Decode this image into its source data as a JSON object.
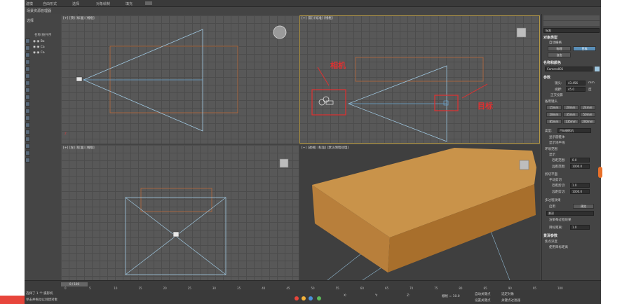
{
  "ribbon": {
    "items": [
      "建模",
      "自由形式",
      "选择",
      "对象绘制",
      "填充"
    ]
  },
  "left_panel": {
    "title": "场景资源管理器",
    "header": "选择",
    "sort_label": "名称(按升序",
    "objects": [
      "Bo",
      "Ca",
      "Ca"
    ]
  },
  "viewports": {
    "top_left": "[+] [顶] [标准] [线框]",
    "top_right": "[+] [前] [标准] [线框]",
    "bottom_left": "[+] [左] [标准] [线框]",
    "bottom_right": "[+] [透视] [标准] [默认明暗处理]"
  },
  "annotations": {
    "camera": "相机",
    "target": "目标"
  },
  "right_panel": {
    "top_select": "标准",
    "object_type_title": "对象类型",
    "auto_grid": "自动栅格",
    "btn_physical": "物理",
    "btn_target": "目标",
    "btn_free": "自由",
    "name_color_title": "名称和颜色",
    "camera_name": "Camera001",
    "params_title": "参数",
    "lens_label": "镜头:",
    "lens_value": "43.456",
    "lens_unit": "mm",
    "fov_label": "视野:",
    "fov_value": "45.0",
    "fov_unit": "度",
    "ortho": "正交投影",
    "stock_lens_title": "备用镜头",
    "stock_lens": [
      "15mm",
      "20mm",
      "24mm",
      "28mm",
      "35mm",
      "50mm",
      "85mm",
      "135mm",
      "200mm"
    ],
    "type_label": "类型:",
    "type_value": "目标摄影机",
    "show_cone": "显示圆锥体",
    "show_horizon": "显示地平线",
    "env_range_title": "环境范围",
    "show": "显示",
    "near_range_label": "近距范围:",
    "near_range_value": "0.0",
    "far_range_label": "远距范围:",
    "far_range_value": "1000.0",
    "clip_title": "剪切平面",
    "manual_clip": "手动剪切",
    "near_clip_label": "近距剪切:",
    "near_clip_value": "1.0",
    "far_clip_label": "远距剪切:",
    "far_clip_value": "1000.0",
    "multipass_title": "多过程效果",
    "enable": "启用",
    "preview": "预览",
    "multipass_type": "景深",
    "render_each_pass": "渲染每过程效果",
    "target_dist_label": "目标距离:",
    "target_dist_value": "1.0",
    "dof_params_title": "景深参数",
    "focal_depth": "焦点深度",
    "use_target_dist": "使用目标距离"
  },
  "timeline": {
    "frame_display": "0 / 100",
    "ticks": [
      "0",
      "5",
      "10",
      "15",
      "20",
      "25",
      "30",
      "35",
      "40",
      "45",
      "50",
      "55",
      "60",
      "65",
      "70",
      "75",
      "80",
      "85",
      "90",
      "95",
      "100"
    ]
  },
  "status": {
    "selected": "选择了 1 个 摄影机",
    "hint": "单击并拖动以创建对象",
    "x_label": "X:",
    "y_label": "Y:",
    "z_label": "Z:",
    "grid": "栅格 = 10.0",
    "auto_key": "自动关键点",
    "selected_obj": "选定对象",
    "set_key": "设置关键点",
    "key_filter": "关键点过滤器"
  },
  "colors": {
    "active_border": "#b69a46",
    "annotation_red": "#e03030",
    "box_orange": "#c9934a",
    "camera_cone": "#9fc7e0"
  }
}
